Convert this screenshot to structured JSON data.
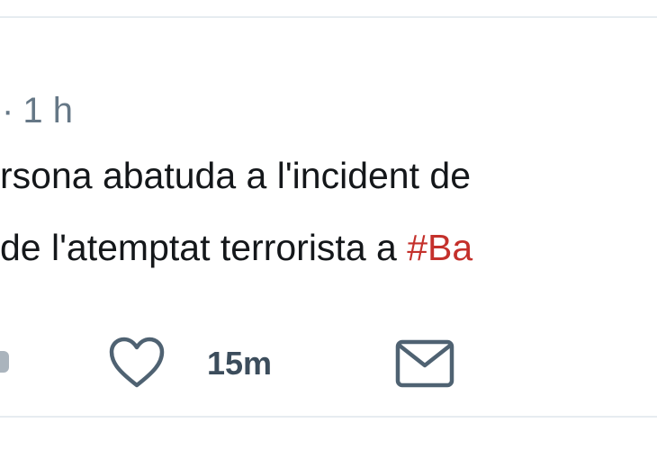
{
  "tweet": {
    "meta": {
      "separator": "·",
      "time_ago": "1 h"
    },
    "text": {
      "line1": "rsona abatuda a l'incident de",
      "line2_prefix": "de l'atemptat terrorista a ",
      "hashtag": "#Ba"
    },
    "actions": {
      "reply_icon": "reply-icon",
      "like_icon": "heart-icon",
      "like_count": "15m",
      "dm_icon": "envelope-icon"
    }
  },
  "colors": {
    "text": "#14171a",
    "muted": "#657786",
    "hashtag": "#c4302b",
    "divider": "#e6ecf0"
  }
}
